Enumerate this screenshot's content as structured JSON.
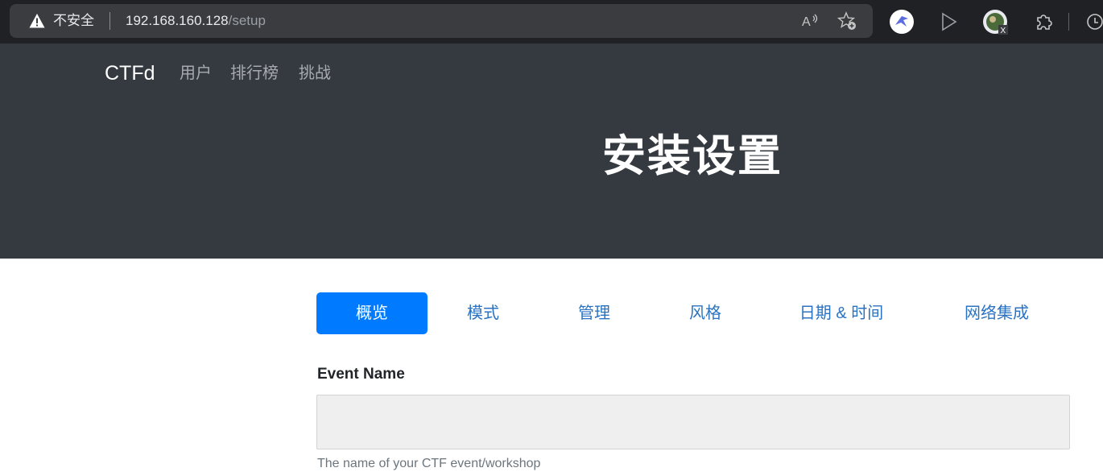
{
  "browser": {
    "security_label": "不安全",
    "url_host": "192.168.160.128",
    "url_path": "/setup",
    "profile_badge": "X"
  },
  "navbar": {
    "brand": "CTFd",
    "links": [
      "用户",
      "排行榜",
      "挑战"
    ]
  },
  "header": {
    "title": "安装设置"
  },
  "tabs": [
    "概览",
    "模式",
    "管理",
    "风格",
    "日期 & 时间",
    "网络集成"
  ],
  "form": {
    "event_name_label": "Event Name",
    "event_name_value": "",
    "event_name_help": "The name of your CTF event/workshop"
  },
  "colors": {
    "header_bg": "#343a40",
    "active_tab": "#007bff",
    "tab_link": "#2b73c0"
  }
}
